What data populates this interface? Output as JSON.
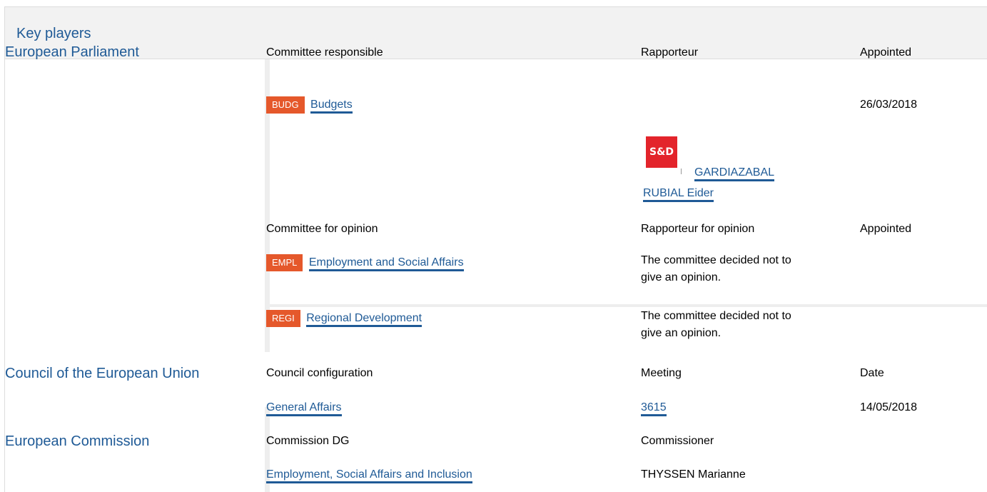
{
  "title": "Key players",
  "colors": {
    "link": "#1f5a96",
    "badge": "#e5582b",
    "sd_logo": "#e3242b"
  },
  "ep": {
    "title": "European Parliament",
    "committee_responsible_label": "Committee responsible",
    "rapporteur_label": "Rapporteur",
    "appointed_label": "Appointed",
    "responsible": {
      "badge": "BUDG",
      "name": "Budgets",
      "date": "26/03/2018"
    },
    "rapporteur": {
      "group_logo": "S&D",
      "name_line1": "GARDIAZABAL",
      "name_line2": "RUBIAL Eider"
    },
    "committee_opinion_label": "Committee for opinion",
    "rapporteur_opinion_label": "Rapporteur for opinion",
    "appointed_opinion_label": "Appointed",
    "opinions": [
      {
        "badge": "EMPL",
        "name": "Employment and Social Affairs",
        "note_line1": "The committee decided not to",
        "note_line2": "give an opinion."
      },
      {
        "badge": "REGI",
        "name": "Regional Development",
        "note_line1": "The committee decided not to",
        "note_line2": "give an opinion."
      }
    ]
  },
  "council": {
    "title": "Council of the European Union",
    "config_label": "Council configuration",
    "meeting_label": "Meeting",
    "date_label": "Date",
    "config": "General Affairs",
    "meeting": "3615",
    "date": "14/05/2018"
  },
  "commission": {
    "title": "European Commission",
    "dg_label": "Commission DG",
    "commissioner_label": "Commissioner",
    "dg": "Employment, Social Affairs and Inclusion",
    "commissioner": "THYSSEN Marianne"
  }
}
